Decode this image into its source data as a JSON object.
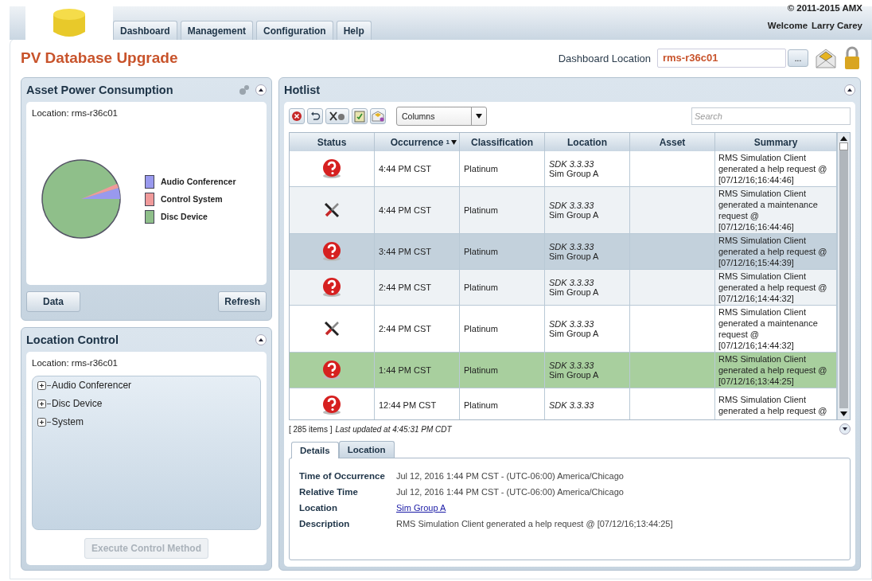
{
  "header": {
    "copyright": "© 2011-2015 AMX",
    "welcome": "Welcome",
    "user": "Larry Carey",
    "tabs": [
      {
        "label": "Dashboard",
        "selected": false
      },
      {
        "label": "Management",
        "selected": false
      },
      {
        "label": "Configuration",
        "selected": false
      },
      {
        "label": "Help",
        "selected": false
      }
    ]
  },
  "page": {
    "title": "PV Database Upgrade",
    "location_label": "Dashboard Location",
    "location_value": "rms-r36c01",
    "browse_button": "..."
  },
  "power_panel": {
    "title": "Asset Power Consumption",
    "location": "Location: rms-r36c01",
    "legend": [
      {
        "label": "Audio Conferencer",
        "color": "#9999ee"
      },
      {
        "label": "Control System",
        "color": "#f09a9a"
      },
      {
        "label": "Disc Device",
        "color": "#8fbf8a"
      }
    ],
    "buttons": [
      "Data",
      "Refresh"
    ]
  },
  "location_panel": {
    "title": "Location Control",
    "location": "Location: rms-r36c01",
    "tree": [
      {
        "label": "Audio Conferencer",
        "expanded": false
      },
      {
        "label": "Disc Device",
        "expanded": false
      },
      {
        "label": "System",
        "expanded": false
      }
    ],
    "execute_button": {
      "label": "Execute Control Method",
      "disabled": true
    }
  },
  "hotlist": {
    "title": "Hotlist",
    "columns_select": "Columns",
    "search": {
      "placeholder": "Search"
    },
    "columns": [
      {
        "label": "Status"
      },
      {
        "label": "Occurrence",
        "sort_rank": "1"
      },
      {
        "label": "Classification"
      },
      {
        "label": "Location"
      },
      {
        "label": "Asset"
      },
      {
        "label": "Summary"
      }
    ],
    "rows": [
      {
        "kind": "help",
        "occurrence": "4:44 PM CST",
        "classification": "Platinum",
        "location_1": "SDK 3.3.33",
        "location_2": "Sim Group A",
        "summary": "RMS Simulation Client generated a help request @ [07/12/16;16:44:46]",
        "selected": false,
        "highlighted": false
      },
      {
        "kind": "maintenance",
        "occurrence": "4:44 PM CST",
        "classification": "Platinum",
        "location_1": "SDK 3.3.33",
        "location_2": "Sim Group A",
        "summary": "RMS Simulation Client generated a maintenance request @ [07/12/16;16:44:46]",
        "selected": false,
        "highlighted": false
      },
      {
        "kind": "help",
        "occurrence": "3:44 PM CST",
        "classification": "Platinum",
        "location_1": "SDK 3.3.33",
        "location_2": "Sim Group A",
        "summary": "RMS Simulation Client generated a help request @ [07/12/16;15:44:39]",
        "selected": false,
        "highlighted": true
      },
      {
        "kind": "help",
        "occurrence": "2:44 PM CST",
        "classification": "Platinum",
        "location_1": "SDK 3.3.33",
        "location_2": "Sim Group A",
        "summary": "RMS Simulation Client generated a help request @ [07/12/16;14:44:32]",
        "selected": false,
        "highlighted": false
      },
      {
        "kind": "maintenance",
        "occurrence": "2:44 PM CST",
        "classification": "Platinum",
        "location_1": "SDK 3.3.33",
        "location_2": "Sim Group A",
        "summary": "RMS Simulation Client generated a maintenance request @ [07/12/16;14:44:32]",
        "selected": false,
        "highlighted": false
      },
      {
        "kind": "help",
        "occurrence": "1:44 PM CST",
        "classification": "Platinum",
        "location_1": "SDK 3.3.33",
        "location_2": "Sim Group A",
        "summary": "RMS Simulation Client generated a help request @ [07/12/16;13:44:25]",
        "selected": true,
        "highlighted": false
      },
      {
        "kind": "help",
        "occurrence": "12:44 PM CST",
        "classification": "Platinum",
        "location_1": "SDK 3.3.33",
        "summary": "RMS Simulation Client generated a help request @",
        "selected": false,
        "highlighted": false
      }
    ],
    "count": "[ 285 items ]",
    "updated": "Last updated at 4:45:31 PM CDT",
    "detail_tabs": [
      {
        "label": "Details",
        "selected": true
      },
      {
        "label": "Location",
        "selected": false
      }
    ],
    "details": [
      {
        "label": "Time of Occurrence",
        "value": "Jul 12, 2016 1:44 PM CST - (UTC-06:00) America/Chicago",
        "kind": "text"
      },
      {
        "label": "Relative Time",
        "value": "Jul 12, 2016 1:44 PM CST - (UTC-06:00) America/Chicago",
        "kind": "text"
      },
      {
        "label": "Location",
        "value": "Sim Group A",
        "kind": "link"
      },
      {
        "label": "Description",
        "value": "RMS Simulation Client generated a help request @ [07/12/16;13:44:25]",
        "kind": "text"
      }
    ]
  }
}
